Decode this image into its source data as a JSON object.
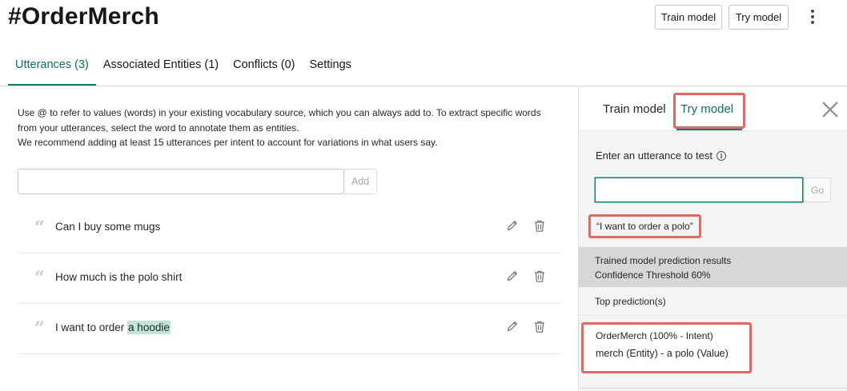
{
  "header": {
    "title": "#OrderMerch",
    "train_label": "Train model",
    "try_label": "Try model",
    "more_icon": "overflow-menu-vertical-icon"
  },
  "tabs": [
    {
      "label": "Utterances (3)",
      "active": true
    },
    {
      "label": "Associated Entities (1)",
      "active": false
    },
    {
      "label": "Conflicts (0)",
      "active": false
    },
    {
      "label": "Settings",
      "active": false
    }
  ],
  "utterances_panel": {
    "description_lines": [
      "Use @ to refer to values (words) in your existing vocabulary source, which you can always add to. To extract specific words",
      "from your utterances, select the word to annotate them as entities.",
      "We recommend adding at least 15 utterances per intent to account for variations in what users say."
    ],
    "add_input_value": "",
    "add_input_placeholder": "",
    "add_label": "Add",
    "items": [
      {
        "prefix": "Can I buy some mugs",
        "entity": ""
      },
      {
        "prefix": "How much is the polo shirt",
        "entity": ""
      },
      {
        "prefix": "I want to order ",
        "entity": "a hoodie"
      }
    ],
    "quote_icon": "quote-icon",
    "edit_icon": "edit-icon",
    "delete_icon": "trash-icon",
    "entity_highlight_color": "#bde5da"
  },
  "try_panel": {
    "train_tab": "Train model",
    "try_tab": "Try model",
    "close_icon": "close-icon",
    "input_label": "Enter an utterance to test",
    "info_icon": "info-icon",
    "test_input_value": "",
    "go_label": "Go",
    "tested_utterance": "“I want to order a polo”",
    "results_title": "Trained model prediction results",
    "confidence": "Confidence Threshold 60%",
    "top_predictions_label": "Top prediction(s)",
    "prediction_intent": "OrderMerch (100% - Intent)",
    "prediction_entity": "merch (Entity) - a polo (Value)"
  },
  "colors": {
    "accent": "#127a6a",
    "accent_text": "#0f6e5f",
    "annotation_red": "#e06a62",
    "panel_bg": "#f4f4f4",
    "results_header_bg": "#d7d7d7"
  }
}
